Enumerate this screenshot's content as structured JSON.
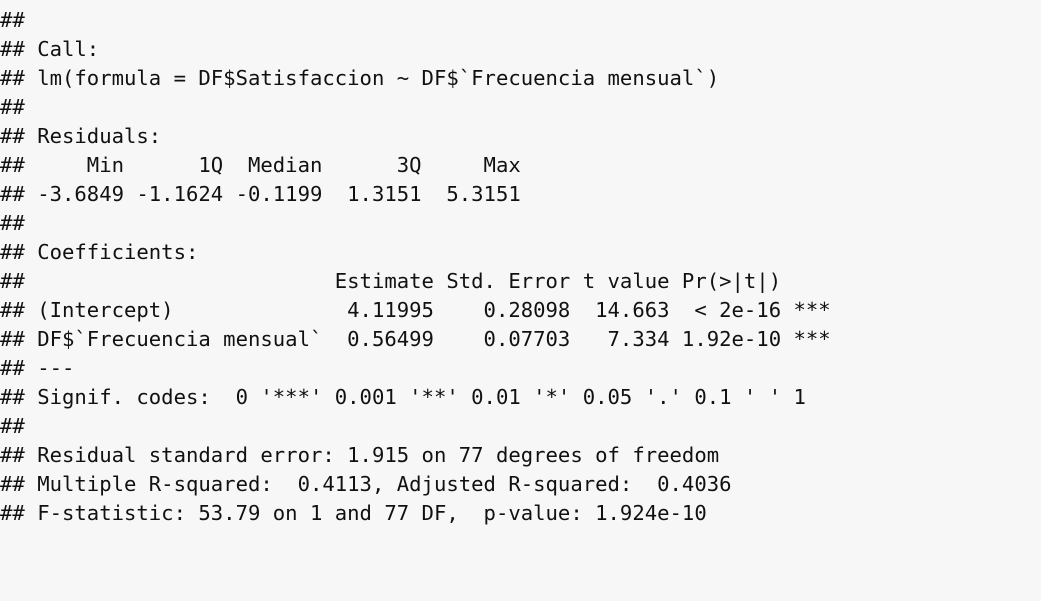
{
  "output": {
    "lines": [
      "##",
      "## Call:",
      "## lm(formula = DF$Satisfaccion ~ DF$`Frecuencia mensual`)",
      "##",
      "## Residuals:",
      "##     Min      1Q  Median      3Q     Max",
      "## -3.6849 -1.1624 -0.1199  1.3151  5.3151",
      "##",
      "## Coefficients:",
      "##                         Estimate Std. Error t value Pr(>|t|)",
      "## (Intercept)              4.11995    0.28098  14.663  < 2e-16 ***",
      "## DF$`Frecuencia mensual`  0.56499    0.07703   7.334 1.92e-10 ***",
      "## ---",
      "## Signif. codes:  0 '***' 0.001 '**' 0.01 '*' 0.05 '.' 0.1 ' ' 1",
      "##",
      "## Residual standard error: 1.915 on 77 degrees of freedom",
      "## Multiple R-squared:  0.4113, Adjusted R-squared:  0.4036",
      "## F-statistic: 53.79 on 1 and 77 DF,  p-value: 1.924e-10"
    ]
  },
  "colors": {
    "background": "#f7f7f7",
    "text": "#111111"
  }
}
